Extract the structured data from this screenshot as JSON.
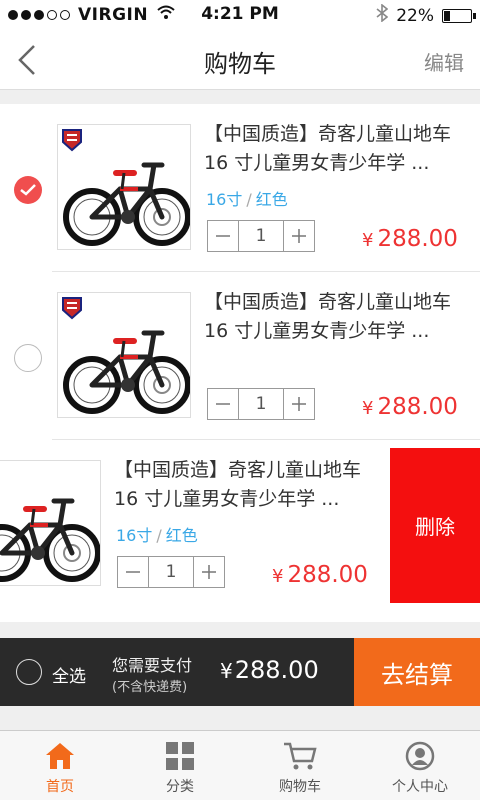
{
  "status_bar": {
    "carrier": "VIRGIN",
    "time": "4:21 PM",
    "battery": "22%",
    "battery_level": 0.22
  },
  "nav": {
    "title": "购物车",
    "edit_label": "编辑",
    "back_icon": "chevron-left-icon"
  },
  "cart": {
    "items": [
      {
        "title_line1": "【中国质造】奇客儿童山地车",
        "title_line2": "16 寸儿童男女青少年学 ...",
        "spec_size": "16寸",
        "spec_sep": "/",
        "spec_color": "红色",
        "quantity": "1",
        "currency": "¥",
        "price": "288.00",
        "checked": true
      },
      {
        "title_line1": "【中国质造】奇客儿童山地车",
        "title_line2": "16 寸儿童男女青少年学 ...",
        "quantity": "1",
        "currency": "¥",
        "price": "288.00",
        "checked": false
      },
      {
        "title_line1": "【中国质造】奇客儿童山地车",
        "title_line2": "16 寸儿童男女青少年学 ...",
        "spec_size": "16寸",
        "spec_sep": "/",
        "spec_color": "红色",
        "quantity": "1",
        "currency": "¥",
        "price": "288.00",
        "delete_label": "删除"
      }
    ]
  },
  "checkout": {
    "select_all": "全选",
    "pay_label": "您需要支付",
    "pay_note": "(不含快递费)",
    "currency": "¥",
    "total": "288.00",
    "button": "去结算"
  },
  "tabs": [
    {
      "label": "首页",
      "icon": "home-icon",
      "active": true
    },
    {
      "label": "分类",
      "icon": "grid-icon",
      "active": false
    },
    {
      "label": "购物车",
      "icon": "cart-icon",
      "active": false
    },
    {
      "label": "个人中心",
      "icon": "user-icon",
      "active": false
    }
  ],
  "colors": {
    "accent": "#f26a1b",
    "price": "#e33333",
    "delete": "#f40f0f",
    "spec": "#3aa8e6",
    "check_on": "#f04e4e"
  }
}
